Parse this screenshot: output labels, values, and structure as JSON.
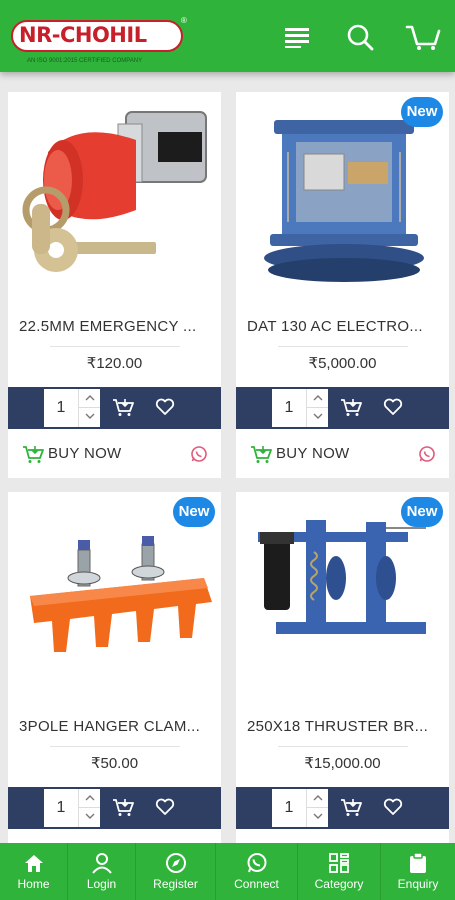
{
  "header": {
    "logo_text": "NR-CHOHIL",
    "logo_tagline": "AN ISO 9001:2015 CERTIFIED COMPANY",
    "logo_registered": "®",
    "brand_color": "#2fb33a"
  },
  "products": [
    {
      "name": "22.5MM EMERGENCY ...",
      "price": "₹120.00",
      "qty": "1",
      "badge": "",
      "buy_label": "BUY NOW"
    },
    {
      "name": "DAT 130 AC ELECTRO...",
      "price": "₹5,000.00",
      "qty": "1",
      "badge": "New",
      "buy_label": "BUY NOW"
    },
    {
      "name": "3POLE HANGER CLAM...",
      "price": "₹50.00",
      "qty": "1",
      "badge": "New",
      "buy_label": ""
    },
    {
      "name": "250X18 THRUSTER BR...",
      "price": "₹15,000.00",
      "qty": "1",
      "badge": "New",
      "buy_label": ""
    }
  ],
  "bottom_nav": [
    {
      "label": "Home",
      "icon": "home-icon"
    },
    {
      "label": "Login",
      "icon": "user-icon"
    },
    {
      "label": "Register",
      "icon": "compass-icon"
    },
    {
      "label": "Connect",
      "icon": "whatsapp-icon"
    },
    {
      "label": "Category",
      "icon": "category-grid-icon"
    },
    {
      "label": "Enquiry",
      "icon": "clipboard-icon"
    }
  ],
  "colors": {
    "qty_bar": "#2f3f63",
    "badge": "#1e88e5",
    "accent_green": "#2fb33a"
  }
}
